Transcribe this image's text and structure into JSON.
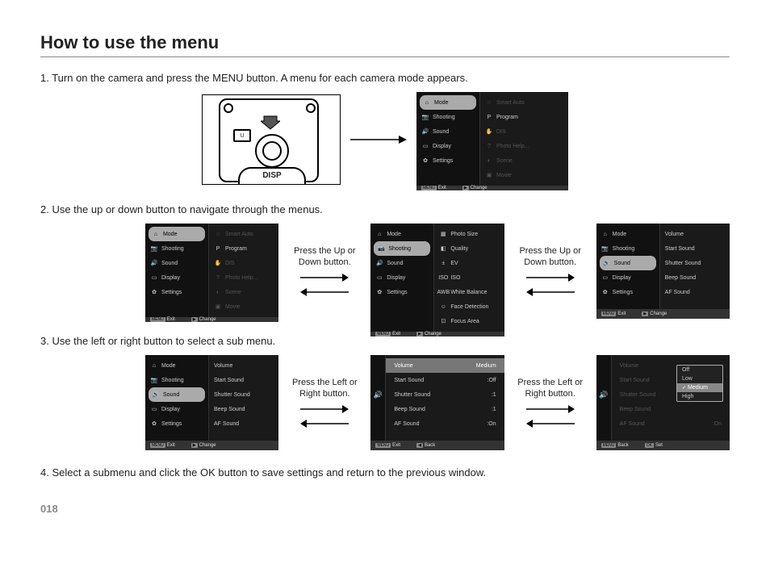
{
  "title": "How to use the menu",
  "steps": {
    "s1": "1. Turn on the camera and press the MENU button. A menu for each camera mode appears.",
    "s2": "2. Use the up or down button to navigate through the menus.",
    "s3": "3. Use the left or right button to select a sub menu.",
    "s4": "4. Select a submenu and click the OK button to save settings and return to the previous window."
  },
  "disp_label": "DISP",
  "menu_tab": "U",
  "captions": {
    "updown": "Press the Up or Down button.",
    "leftright": "Press the Left or Right button."
  },
  "menu": {
    "left": {
      "mode": "Mode",
      "shooting": "Shooting",
      "sound": "Sound",
      "display": "Display",
      "settings": "Settings"
    },
    "modeRight": {
      "smartauto": "Smart Auto",
      "program": "Program",
      "dis": "DIS",
      "photohelp": "Photo Help...",
      "scene": "Scene",
      "movie": "Movie"
    },
    "shootingRight": {
      "photosize": "Photo Size",
      "quality": "Quality",
      "ev": "EV",
      "iso": "ISO",
      "wb": "White Balance",
      "face": "Face Detection",
      "focus": "Focus Area"
    },
    "soundRight": {
      "volume": "Volume",
      "startsound": "Start Sound",
      "shuttersound": "Shutter Sound",
      "beepsound": "Beep Sound",
      "afsound": "AF Sound"
    },
    "soundValues": {
      "volume": "Medium",
      "startsound": ":Off",
      "shuttersound": ":1",
      "beepsound": ":1",
      "afsound": ":On"
    },
    "popup": {
      "off": "Off",
      "low": "Low",
      "medium": "Medium",
      "high": "High"
    },
    "footer": {
      "menu": "MENU",
      "exit": "Exit",
      "change": "Change",
      "back": "Back",
      "ok": "OK",
      "set": "Set"
    }
  },
  "page_number": "018"
}
